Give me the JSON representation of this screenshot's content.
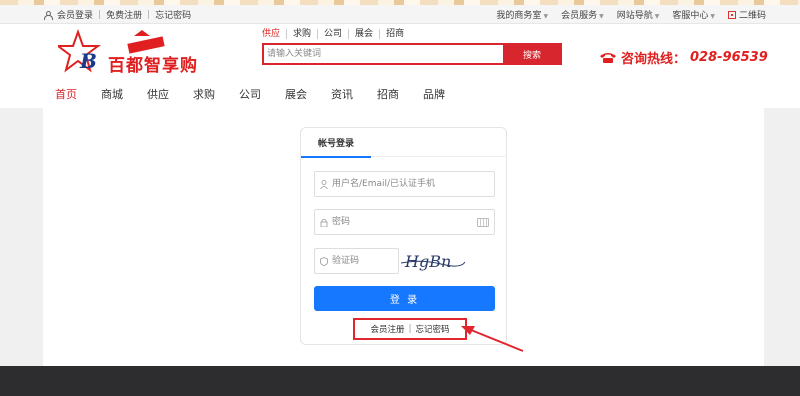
{
  "topbar": {
    "login": "会员登录",
    "register": "免费注册",
    "forgot": "忘记密码",
    "right": [
      "我的商务室",
      "会员服务",
      "网站导航",
      "客服中心"
    ],
    "qrcode": "二维码"
  },
  "logo": {
    "brand": "百都智享购",
    "letter": "B"
  },
  "search": {
    "tabs": [
      "供应",
      "求购",
      "公司",
      "展会",
      "招商"
    ],
    "placeholder": "请输入关键词",
    "button": "搜索"
  },
  "hotline": {
    "label": "咨询热线：",
    "number": "028-96539"
  },
  "nav": [
    "首页",
    "商城",
    "供应",
    "求购",
    "公司",
    "展会",
    "资讯",
    "招商",
    "品牌"
  ],
  "login": {
    "tab": "帐号登录",
    "username_placeholder": "用户名/Email/已认证手机",
    "password_placeholder": "密码",
    "captcha_placeholder": "验证码",
    "captcha_text": "HgBn",
    "button": "登 录",
    "register_link": "会员注册",
    "link_separator": "|",
    "forgot_link": "忘记密码"
  },
  "colors": {
    "brand_red": "#d8262e",
    "accent_blue": "#1677ff",
    "footer": "#2d2d2f"
  }
}
